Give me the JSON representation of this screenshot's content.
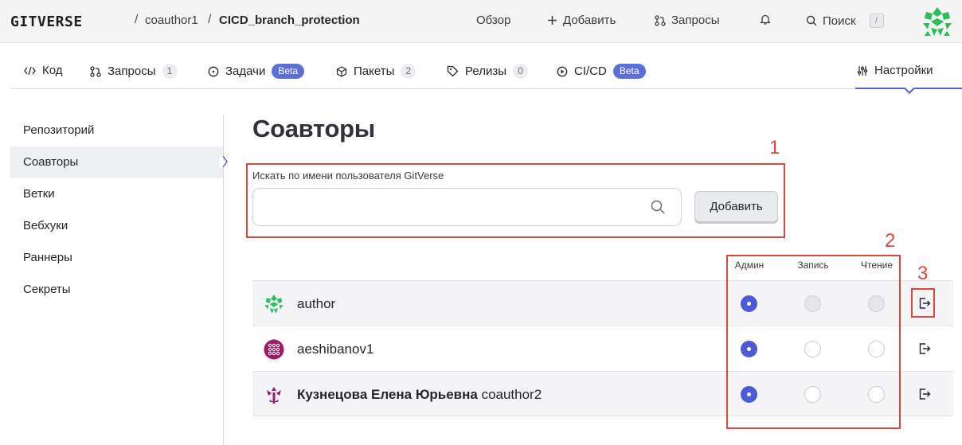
{
  "header": {
    "logo": "GITVERSE",
    "breadcrumb_owner": "coauthor1",
    "breadcrumb_sep": "/",
    "breadcrumb_repo": "CICD_branch_protection",
    "nav": {
      "overview": "Обзор",
      "add": "Добавить",
      "requests": "Запросы",
      "search": "Поиск",
      "search_shortcut": "/"
    }
  },
  "tabs": [
    {
      "label": "Код",
      "icon": "code-icon"
    },
    {
      "label": "Запросы",
      "count": "1",
      "icon": "pull-request-icon"
    },
    {
      "label": "Задачи",
      "badge": "Beta",
      "icon": "issue-icon"
    },
    {
      "label": "Пакеты",
      "count": "2",
      "icon": "package-icon"
    },
    {
      "label": "Релизы",
      "count": "0",
      "icon": "tag-icon"
    },
    {
      "label": "CI/CD",
      "badge": "Beta",
      "icon": "play-circle-icon"
    },
    {
      "label": "Настройки",
      "icon": "sliders-icon",
      "active": true
    }
  ],
  "sidebar": {
    "items": [
      {
        "label": "Репозиторий"
      },
      {
        "label": "Соавторы",
        "active": true
      },
      {
        "label": "Ветки"
      },
      {
        "label": "Вебхуки"
      },
      {
        "label": "Раннеры"
      },
      {
        "label": "Секреты"
      }
    ]
  },
  "main": {
    "title": "Соавторы",
    "search_label": "Искать по имени пользователя GitVerse",
    "search_value": "",
    "add_button": "Добавить",
    "columns": {
      "admin": "Админ",
      "write": "Запись",
      "read": "Чтение"
    },
    "collaborators": [
      {
        "name": "author",
        "fullname": "",
        "role": "admin",
        "editable": false
      },
      {
        "name": "aeshibanov1",
        "fullname": "",
        "role": "admin",
        "editable": true
      },
      {
        "name": "coauthor2",
        "fullname": "Кузнецова Елена Юрьевна",
        "role": "admin",
        "editable": true
      }
    ]
  },
  "annotations": {
    "n1": "1",
    "n2": "2",
    "n3": "3",
    "color": "#d9473d"
  },
  "colors": {
    "accent": "#4b5bd6",
    "beta": "#5b6fd8",
    "avatar_green": "#2bbf5c",
    "avatar_purple": "#a0166b"
  }
}
